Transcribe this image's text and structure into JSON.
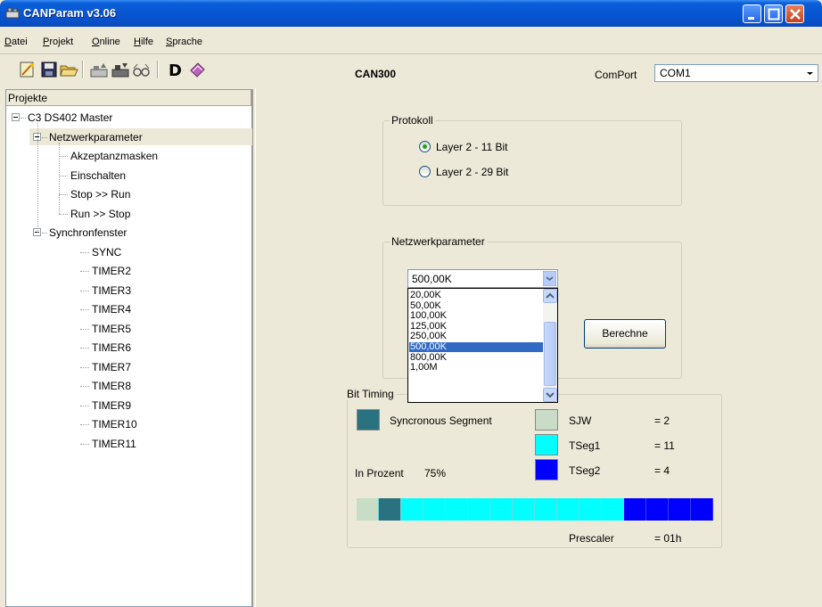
{
  "window": {
    "title": "CANParam v3.06",
    "icon": "can-app-icon",
    "controls": [
      "minimize-icon",
      "maximize-icon",
      "close-icon"
    ]
  },
  "menu": {
    "items": [
      {
        "accel": "D",
        "rest": "atei"
      },
      {
        "accel": "P",
        "rest": "rojekt"
      },
      {
        "accel": "O",
        "rest": "nline"
      },
      {
        "accel": "H",
        "rest": "ilfe"
      },
      {
        "accel": "S",
        "rest": "prache"
      }
    ]
  },
  "toolbar": {
    "icons": [
      "new-icon",
      "save-icon",
      "open-icon",
      "upload-icon",
      "download-icon",
      "view-icon",
      "d-icon",
      "book-icon"
    ],
    "device": "CAN300",
    "comport_label": "ComPort",
    "comport_value": "COM1"
  },
  "tree": {
    "header": "Projekte",
    "items": [
      {
        "label": "C3 DS402 Master",
        "level": 0,
        "expander": true
      },
      {
        "label": "Netzwerkparameter",
        "level": 1,
        "expander": true,
        "selected": true
      },
      {
        "label": "Akzeptanzmasken",
        "level": 2
      },
      {
        "label": "Einschalten",
        "level": 2
      },
      {
        "label": "Stop >> Run",
        "level": 2
      },
      {
        "label": "Run >> Stop",
        "level": 2
      },
      {
        "label": "Synchronfenster",
        "level": 1,
        "expander": true
      },
      {
        "label": "SYNC",
        "level": 3
      },
      {
        "label": "TIMER2",
        "level": 3
      },
      {
        "label": "TIMER3",
        "level": 3
      },
      {
        "label": "TIMER4",
        "level": 3
      },
      {
        "label": "TIMER5",
        "level": 3
      },
      {
        "label": "TIMER6",
        "level": 3
      },
      {
        "label": "TIMER7",
        "level": 3
      },
      {
        "label": "TIMER8",
        "level": 3
      },
      {
        "label": "TIMER9",
        "level": 3
      },
      {
        "label": "TIMER10",
        "level": 3
      },
      {
        "label": "TIMER11",
        "level": 3
      }
    ]
  },
  "protokoll": {
    "title": "Protokoll",
    "options": [
      {
        "label": "Layer 2 - 11 Bit",
        "checked": true
      },
      {
        "label": "Layer 2 - 29 Bit",
        "checked": false
      }
    ]
  },
  "netzwerk": {
    "title": "Netzwerkparameter",
    "selected": "500,00K",
    "options": [
      "20,00K",
      "50,00K",
      "100,00K",
      "125,00K",
      "250,00K",
      "500,00K",
      "800,00K",
      "1,00M"
    ],
    "calc_button": "Berechne"
  },
  "bit_timing": {
    "title": "Bit Timing",
    "sync_label": "Syncronous Segment",
    "percent_label": "In Prozent",
    "percent_value": "75%",
    "sjw_label": "SJW",
    "sjw_value": "= 2",
    "tseg1_label": "TSeg1",
    "tseg1_value": "= 11",
    "tseg2_label": "TSeg2",
    "tseg2_value": "= 4",
    "prescaler_label": "Prescaler",
    "prescaler_value": "= 01h",
    "colors": {
      "sync": "#2b7280",
      "sjw": "#c8dcc8",
      "tseg1": "#00ffff",
      "tseg2": "#0000ff"
    },
    "bar_segments": {
      "sjw": 1,
      "sync": 1,
      "tseg1": 10,
      "tseg2": 4
    }
  }
}
